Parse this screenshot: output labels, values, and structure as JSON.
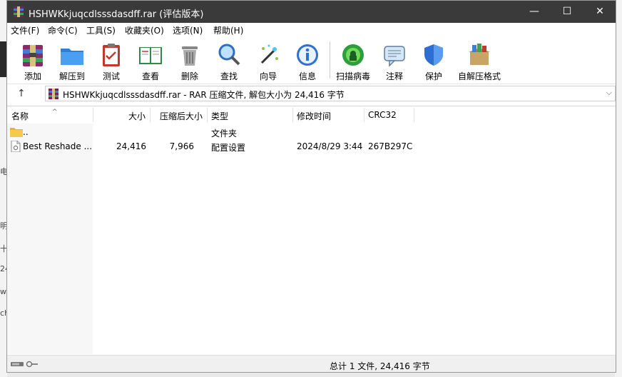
{
  "window": {
    "title": "HSHWKkjuqcdlsssdasdff.rar (评估版本)",
    "controls": {
      "minimize": "—",
      "maximize": "☐",
      "close": "✕"
    }
  },
  "menu": [
    "文件(F)",
    "命令(C)",
    "工具(S)",
    "收藏夹(O)",
    "选项(N)",
    "帮助(H)"
  ],
  "toolbar": [
    {
      "label": "添加",
      "icon": "add-archive-icon"
    },
    {
      "label": "解压到",
      "icon": "extract-folder-icon"
    },
    {
      "label": "测试",
      "icon": "test-clipboard-icon"
    },
    {
      "label": "查看",
      "icon": "view-book-icon"
    },
    {
      "label": "删除",
      "icon": "trash-icon"
    },
    {
      "label": "查找",
      "icon": "magnifier-icon"
    },
    {
      "label": "向导",
      "icon": "wizard-wand-icon"
    },
    {
      "label": "信息",
      "icon": "info-icon"
    },
    {
      "label": "扫描病毒",
      "icon": "virus-scan-icon"
    },
    {
      "label": "注释",
      "icon": "comment-icon"
    },
    {
      "label": "保护",
      "icon": "shield-icon"
    },
    {
      "label": "自解压格式",
      "icon": "sfx-box-icon"
    }
  ],
  "address": {
    "up": "↑",
    "path": "HSHWKkjuqcdlsssdasdff.rar - RAR 压缩文件, 解包大小为 24,416 字节",
    "dropdown": "⌵"
  },
  "columns": {
    "name": "名称",
    "size": "大小",
    "packed": "压缩后大小",
    "type": "类型",
    "modified": "修改时间",
    "crc": "CRC32"
  },
  "sort_caret": "^",
  "rows": [
    {
      "name": "..",
      "size": "",
      "packed": "",
      "type": "文件夹",
      "modified": "",
      "crc": "",
      "icon": "folder-icon"
    },
    {
      "name": "Best Reshade ...",
      "size": "24,416",
      "packed": "7,966",
      "type": "配置设置",
      "modified": "2024/8/29 3:44",
      "crc": "267B297C",
      "icon": "config-file-icon"
    }
  ],
  "status": {
    "text": "总计 1 文件, 24,416 字节"
  },
  "background_fragments": [
    "电",
    "明",
    "十",
    "24",
    "w",
    "ch"
  ]
}
